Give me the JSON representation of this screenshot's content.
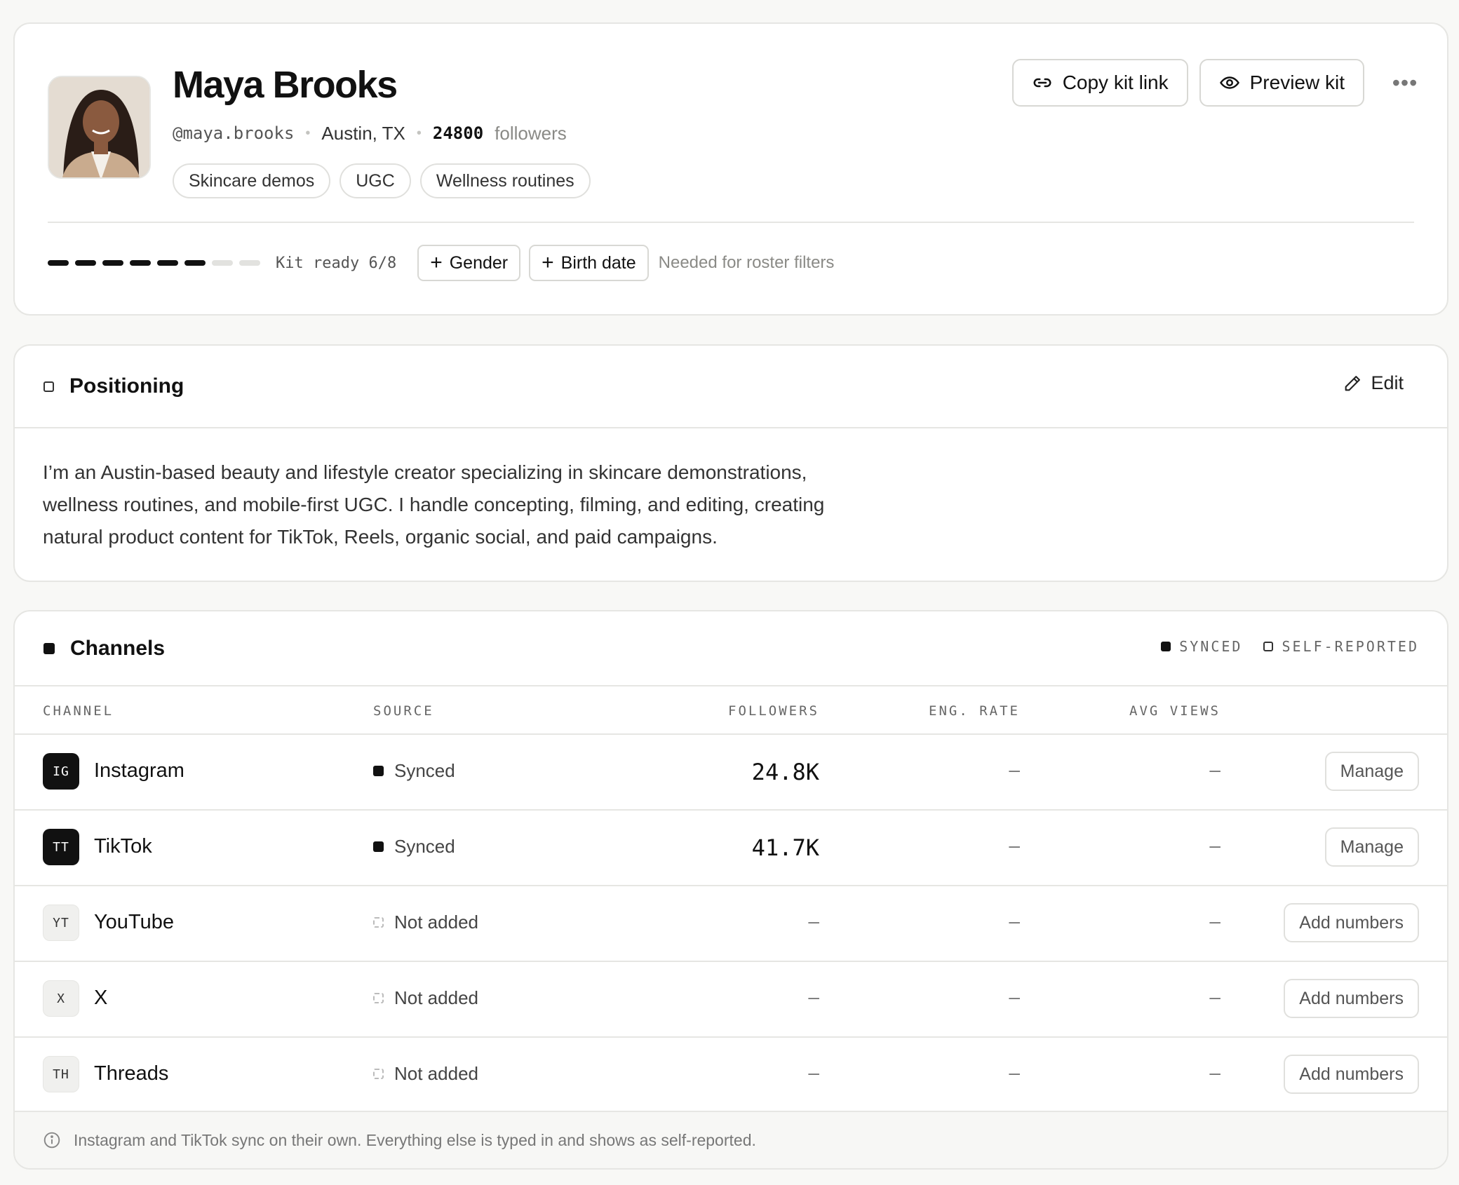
{
  "profile": {
    "name": "Maya Brooks",
    "handle": "@maya.brooks",
    "location": "Austin, TX",
    "followers_count": "24800",
    "followers_label": "followers",
    "tags": [
      "Skincare demos",
      "UGC",
      "Wellness routines"
    ],
    "actions": {
      "copy_link": "Copy kit link",
      "preview": "Preview kit",
      "more": "•••"
    },
    "kit": {
      "completed": 6,
      "total": 8,
      "label": "Kit ready 6/8",
      "missing": [
        "Gender",
        "Birth date"
      ],
      "hint": "Needed for roster filters"
    }
  },
  "positioning": {
    "title": "Positioning",
    "edit_label": "Edit",
    "bio": "I’m an Austin-based beauty and lifestyle creator specializing in skincare demonstrations, wellness routines, and mobile-first UGC. I handle concepting, filming, and editing, creating natural product content for TikTok, Reels, organic social, and paid campaigns."
  },
  "channels": {
    "title": "Channels",
    "legend": {
      "synced": "SYNCED",
      "self_reported": "SELF-REPORTED"
    },
    "columns": [
      "CHANNEL",
      "SOURCE",
      "FOLLOWERS",
      "ENG. RATE",
      "AVG VIEWS"
    ],
    "rows": [
      {
        "abbr": "IG",
        "name": "Instagram",
        "source": "Synced",
        "followers": "24.8K",
        "eng_rate": "–",
        "avg_views": "–",
        "action": "Manage",
        "synced": true
      },
      {
        "abbr": "TT",
        "name": "TikTok",
        "source": "Synced",
        "followers": "41.7K",
        "eng_rate": "–",
        "avg_views": "–",
        "action": "Manage",
        "synced": true
      },
      {
        "abbr": "YT",
        "name": "YouTube",
        "source": "Not added",
        "followers": "–",
        "eng_rate": "–",
        "avg_views": "–",
        "action": "Add numbers",
        "synced": false
      },
      {
        "abbr": "X",
        "name": "X",
        "source": "Not added",
        "followers": "–",
        "eng_rate": "–",
        "avg_views": "–",
        "action": "Add numbers",
        "synced": false
      },
      {
        "abbr": "TH",
        "name": "Threads",
        "source": "Not added",
        "followers": "–",
        "eng_rate": "–",
        "avg_views": "–",
        "action": "Add numbers",
        "synced": false
      }
    ],
    "footer_note": "Instagram and TikTok sync on their own. Everything else is typed in and shows as self-reported."
  },
  "icons": {
    "link": "link-icon",
    "preview": "eye-icon",
    "edit": "pencil-icon",
    "info": "info-icon"
  },
  "colors": {
    "background": "#f8f8f6",
    "card": "#ffffff",
    "border": "#e6e6e3",
    "ink": "#111111",
    "muted": "#8a8a86"
  }
}
